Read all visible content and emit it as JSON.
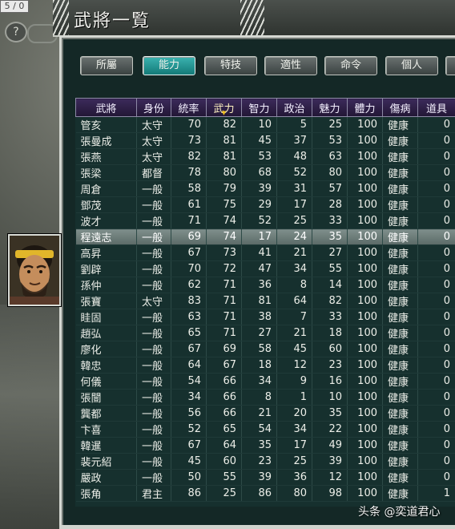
{
  "corner_label": "5 / 0",
  "help_glyph": "?",
  "window_title": "武將一覧",
  "tabs": [
    {
      "label": "所屬",
      "active": false
    },
    {
      "label": "能力",
      "active": true
    },
    {
      "label": "特技",
      "active": false
    },
    {
      "label": "適性",
      "active": false
    },
    {
      "label": "命令",
      "active": false
    },
    {
      "label": "個人",
      "active": false
    }
  ],
  "columns": [
    "武將",
    "身份",
    "統率",
    "武力",
    "智力",
    "政治",
    "魅力",
    "體力",
    "傷病",
    "道具"
  ],
  "sorted_column": "武力",
  "selected_row": 7,
  "rows": [
    [
      "管亥",
      "太守",
      "70",
      "82",
      "10",
      "5",
      "25",
      "100",
      "健康",
      "0"
    ],
    [
      "張曼成",
      "太守",
      "73",
      "81",
      "45",
      "37",
      "53",
      "100",
      "健康",
      "0"
    ],
    [
      "張燕",
      "太守",
      "82",
      "81",
      "53",
      "48",
      "63",
      "100",
      "健康",
      "0"
    ],
    [
      "張梁",
      "都督",
      "78",
      "80",
      "68",
      "52",
      "80",
      "100",
      "健康",
      "0"
    ],
    [
      "周倉",
      "一般",
      "58",
      "79",
      "39",
      "31",
      "57",
      "100",
      "健康",
      "0"
    ],
    [
      "鄧茂",
      "一般",
      "61",
      "75",
      "29",
      "17",
      "28",
      "100",
      "健康",
      "0"
    ],
    [
      "波才",
      "一般",
      "71",
      "74",
      "52",
      "25",
      "33",
      "100",
      "健康",
      "0"
    ],
    [
      "程遠志",
      "一般",
      "69",
      "74",
      "17",
      "24",
      "35",
      "100",
      "健康",
      "0"
    ],
    [
      "高昇",
      "一般",
      "67",
      "73",
      "41",
      "21",
      "27",
      "100",
      "健康",
      "0"
    ],
    [
      "劉辟",
      "一般",
      "70",
      "72",
      "47",
      "34",
      "55",
      "100",
      "健康",
      "0"
    ],
    [
      "孫仲",
      "一般",
      "62",
      "71",
      "36",
      "8",
      "14",
      "100",
      "健康",
      "0"
    ],
    [
      "張寶",
      "太守",
      "83",
      "71",
      "81",
      "64",
      "82",
      "100",
      "健康",
      "0"
    ],
    [
      "眭固",
      "一般",
      "63",
      "71",
      "38",
      "7",
      "33",
      "100",
      "健康",
      "0"
    ],
    [
      "趙弘",
      "一般",
      "65",
      "71",
      "27",
      "21",
      "18",
      "100",
      "健康",
      "0"
    ],
    [
      "廖化",
      "一般",
      "67",
      "69",
      "58",
      "45",
      "60",
      "100",
      "健康",
      "0"
    ],
    [
      "韓忠",
      "一般",
      "64",
      "67",
      "18",
      "12",
      "23",
      "100",
      "健康",
      "0"
    ],
    [
      "何儀",
      "一般",
      "54",
      "66",
      "34",
      "9",
      "16",
      "100",
      "健康",
      "0"
    ],
    [
      "張闓",
      "一般",
      "34",
      "66",
      "8",
      "1",
      "10",
      "100",
      "健康",
      "0"
    ],
    [
      "龔都",
      "一般",
      "56",
      "66",
      "21",
      "20",
      "35",
      "100",
      "健康",
      "0"
    ],
    [
      "卞喜",
      "一般",
      "52",
      "65",
      "54",
      "34",
      "22",
      "100",
      "健康",
      "0"
    ],
    [
      "韓暹",
      "一般",
      "67",
      "64",
      "35",
      "17",
      "49",
      "100",
      "健康",
      "0"
    ],
    [
      "裴元紹",
      "一般",
      "45",
      "60",
      "23",
      "25",
      "39",
      "100",
      "健康",
      "0"
    ],
    [
      "嚴政",
      "一般",
      "50",
      "55",
      "39",
      "36",
      "12",
      "100",
      "健康",
      "0"
    ],
    [
      "張角",
      "君主",
      "86",
      "25",
      "86",
      "80",
      "98",
      "100",
      "健康",
      "1"
    ]
  ],
  "watermark": "头条 @奕道君心",
  "colors": {
    "panel": "#142826",
    "header": "#2e2046",
    "active_tab": "#1f9593",
    "selected_row": "#6d7d7a"
  }
}
